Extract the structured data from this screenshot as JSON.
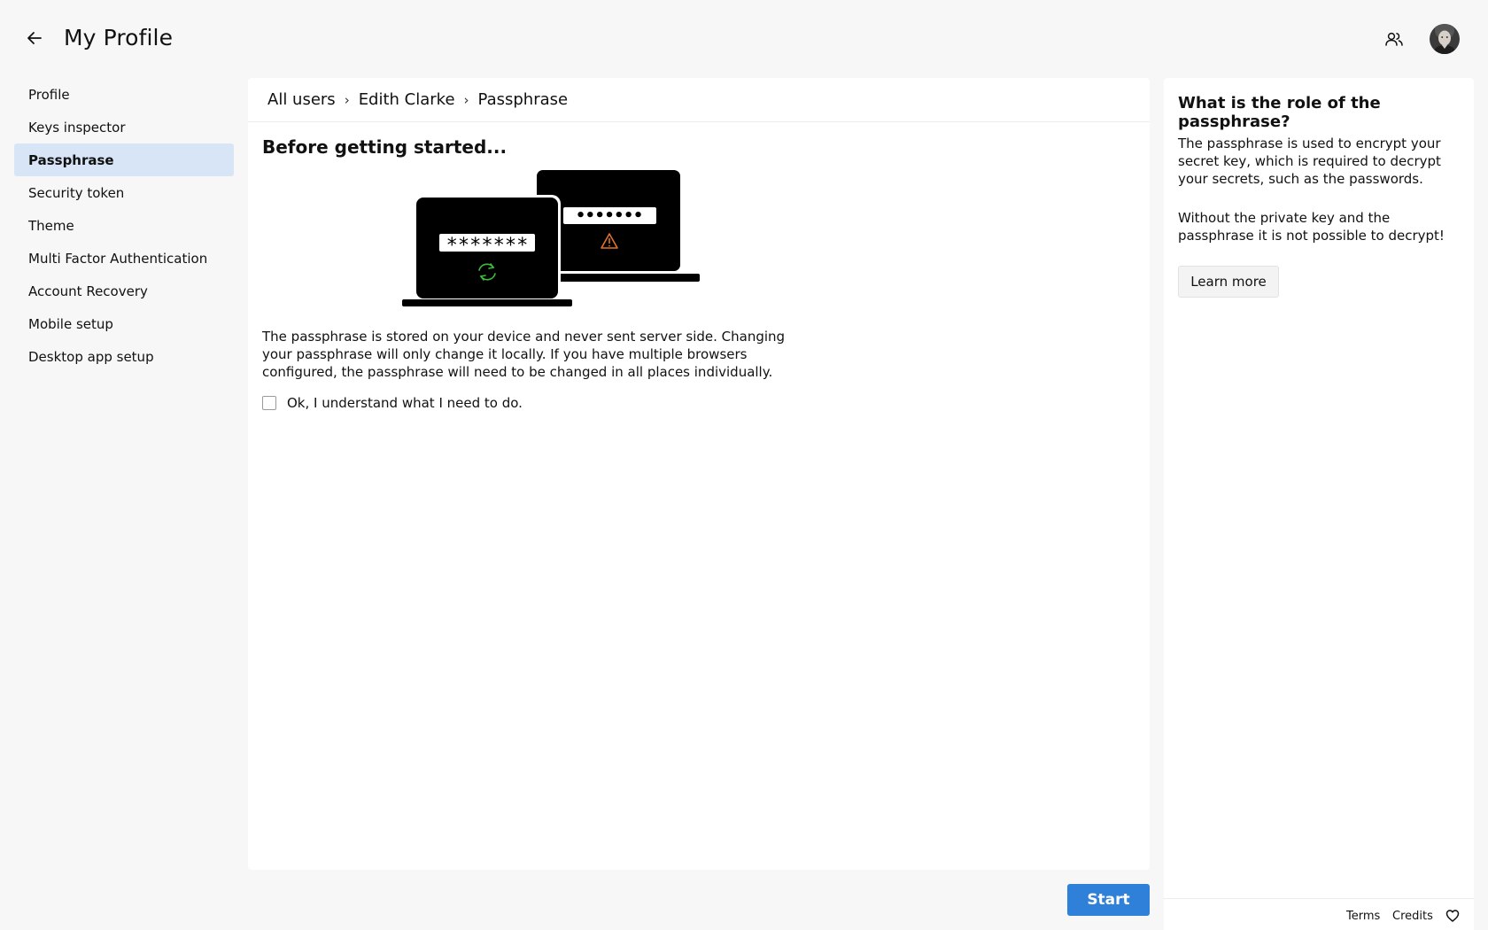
{
  "header": {
    "title": "My Profile",
    "back_icon": "arrow-left-icon",
    "users_icon": "users-icon"
  },
  "sidebar": {
    "items": [
      {
        "label": "Profile"
      },
      {
        "label": "Keys inspector"
      },
      {
        "label": "Passphrase",
        "active": true
      },
      {
        "label": "Security token"
      },
      {
        "label": "Theme"
      },
      {
        "label": "Multi Factor Authentication"
      },
      {
        "label": "Account Recovery"
      },
      {
        "label": "Mobile setup"
      },
      {
        "label": "Desktop app setup"
      }
    ]
  },
  "breadcrumb": {
    "items": [
      "All users",
      "Edith Clarke",
      "Passphrase"
    ],
    "separator": "›"
  },
  "main": {
    "title": "Before getting started...",
    "illustration": {
      "front_password": "*******",
      "back_password": "•••••••",
      "front_icon": "sync-icon",
      "back_icon": "warning-icon"
    },
    "description": "The passphrase is stored on your device and never sent server side. Changing your passphrase will only change it locally. If you have multiple browsers configured, the passphrase will need to be changed in all places individually.",
    "confirm_label": "Ok, I understand what I need to do.",
    "confirm_checked": false,
    "start_label": "Start"
  },
  "help": {
    "title": "What is the role of the passphrase?",
    "paragraph1": "The passphrase is used to encrypt your secret key, which is required to decrypt your secrets, such as the passwords.",
    "paragraph2": "Without the private key and the passphrase it is not possible to decrypt!",
    "learn_more_label": "Learn more"
  },
  "footer": {
    "terms": "Terms",
    "credits": "Credits",
    "heart_icon": "heart-icon"
  },
  "colors": {
    "accent": "#2f80d9",
    "active_nav": "#d7e5f6",
    "sync_green": "#3bbf3b",
    "warning_orange": "#e0702a"
  }
}
